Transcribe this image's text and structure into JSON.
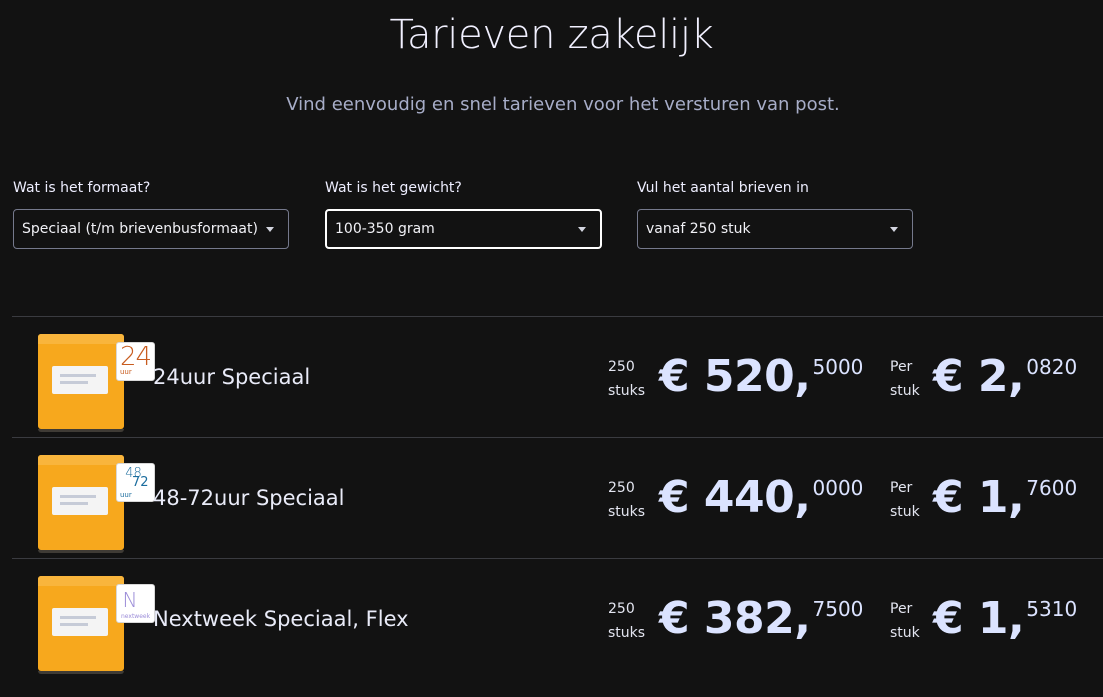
{
  "header": {
    "title": "Tarieven zakelijk",
    "subtitle": "Vind eenvoudig en snel tarieven voor het versturen van post."
  },
  "filters": [
    {
      "label": "Wat is het formaat?",
      "value": "Speciaal (t/m brievenbusformaat)",
      "active": false
    },
    {
      "label": "Wat is het gewicht?",
      "value": "100-350 gram",
      "active": true
    },
    {
      "label": "Vul het aantal brieven in",
      "value": "vanaf 250 stuk",
      "active": false
    }
  ],
  "products": [
    {
      "name": "24uur Speciaal",
      "badge_main": "24",
      "badge_sub": "uur",
      "qty_line1": "250",
      "qty_line2": "stuks",
      "total_main": "€ 520,",
      "total_dec": "5000",
      "per_line1": "Per",
      "per_line2": "stuk",
      "unit_main": "€ 2,",
      "unit_dec": "0820"
    },
    {
      "name": "48-72uur Speciaal",
      "badge_main": "48",
      "badge_main2": "72",
      "badge_sub": "uur",
      "qty_line1": "250",
      "qty_line2": "stuks",
      "total_main": "€ 440,",
      "total_dec": "0000",
      "per_line1": "Per",
      "per_line2": "stuk",
      "unit_main": "€ 1,",
      "unit_dec": "7600"
    },
    {
      "name": "Nextweek Speciaal, Flex",
      "badge_main": "N",
      "badge_sub": "nextweek",
      "qty_line1": "250",
      "qty_line2": "stuks",
      "total_main": "€ 382,",
      "total_dec": "7500",
      "per_line1": "Per",
      "per_line2": "stuk",
      "unit_main": "€ 1,",
      "unit_dec": "5310"
    }
  ],
  "colors": {
    "background": "#121212",
    "envelope": "#f7a81d",
    "price": "#dbe3ff",
    "divider": "#3a3b40"
  }
}
